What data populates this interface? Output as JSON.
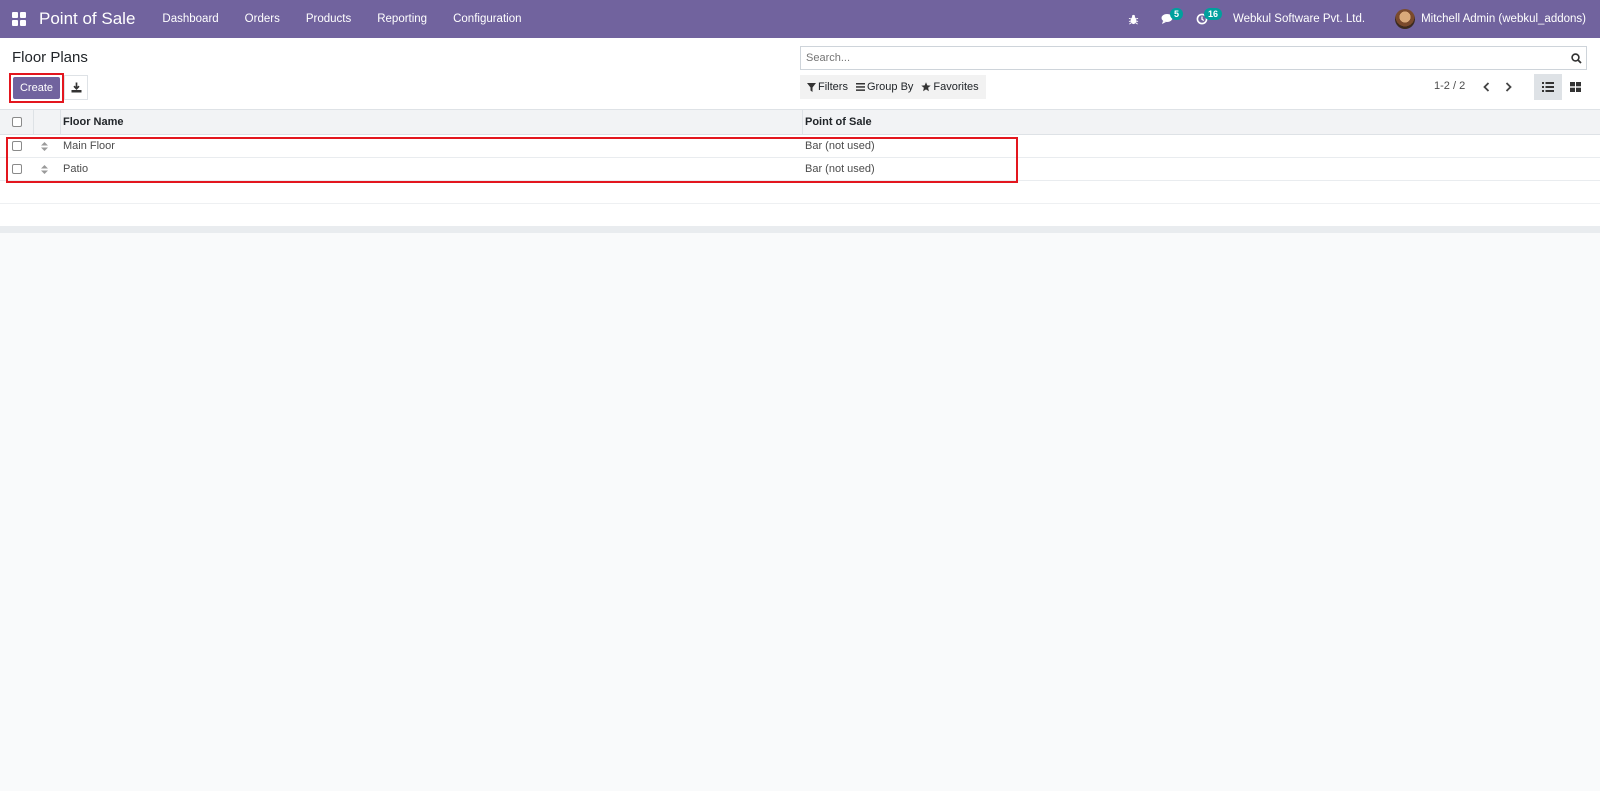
{
  "navbar": {
    "app_name": "Point of Sale",
    "menu": [
      "Dashboard",
      "Orders",
      "Products",
      "Reporting",
      "Configuration"
    ],
    "messages_count": "5",
    "activities_count": "16",
    "company": "Webkul Software Pvt. Ltd.",
    "user": "Mitchell Admin (webkul_addons)",
    "color": "#71639e"
  },
  "control_panel": {
    "title": "Floor Plans",
    "create_label": "Create",
    "search_placeholder": "Search...",
    "filters_label": "Filters",
    "group_by_label": "Group By",
    "favorites_label": "Favorites",
    "pager": "1-2 / 2"
  },
  "list": {
    "columns": [
      "Floor Name",
      "Point of Sale"
    ],
    "rows": [
      {
        "name": "Main Floor",
        "pos": "Bar (not used)"
      },
      {
        "name": "Patio",
        "pos": "Bar (not used)"
      }
    ]
  },
  "icons": [
    "apps-icon",
    "bug-icon",
    "chat-icon",
    "clock-icon",
    "download-icon",
    "search-icon",
    "filter-icon",
    "bars-icon",
    "star-icon",
    "chevron-left-icon",
    "chevron-right-icon",
    "list-view-icon",
    "kanban-view-icon",
    "sort-handle-icon"
  ],
  "highlight_color": "#e3161e"
}
